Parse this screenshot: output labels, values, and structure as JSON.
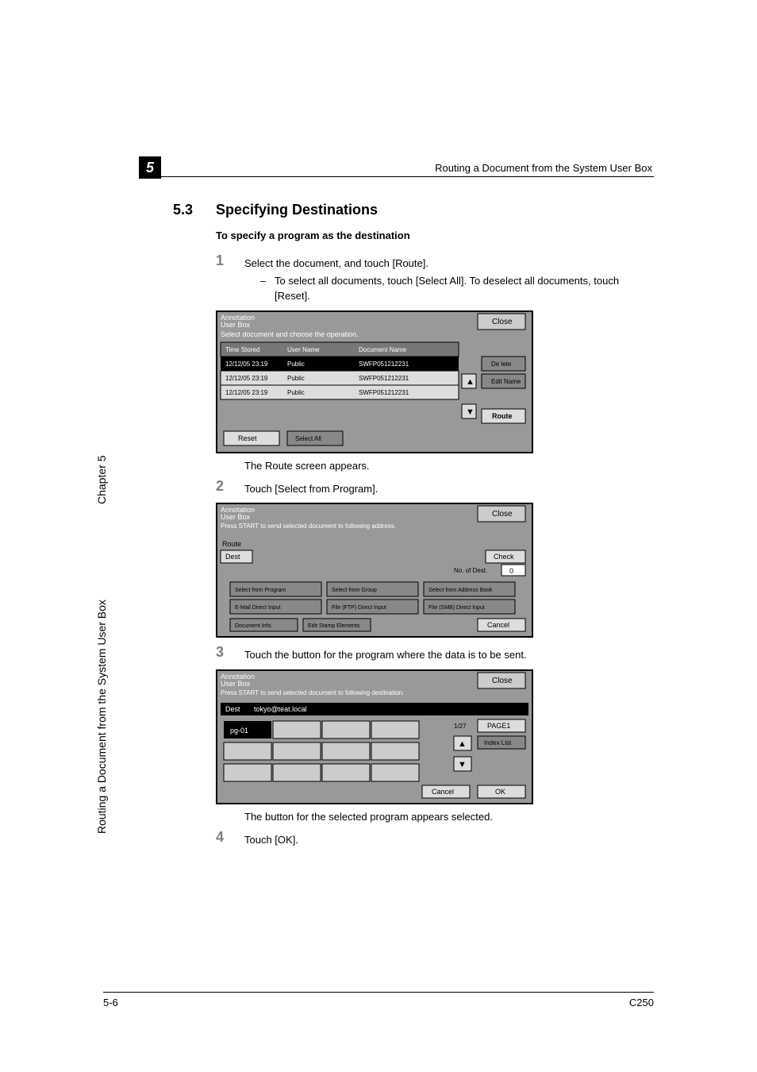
{
  "chapter_box_num": "5",
  "header_text": "Routing a Document from the System User Box",
  "section_num": "5.3",
  "section_title": "Specifying Destinations",
  "sub_heading": "To specify a program as the destination",
  "step1_num": "1",
  "step1_text": "Select the document, and touch [Route].",
  "step1_bullet": "To select all documents, touch [Select All]. To deselect all documents, touch [Reset].",
  "intertext1": "The Route screen appears.",
  "step2_num": "2",
  "step2_text": "Touch [Select from Program].",
  "step3_num": "3",
  "step3_text": "Touch the button for the program where the data is to be sent.",
  "intertext3": "The button for the selected program appears selected.",
  "step4_num": "4",
  "step4_text": "Touch [OK].",
  "sidebar_text": "Routing a Document from the System User Box",
  "sidebar_chapter": "Chapter 5",
  "footer_left": "5-6",
  "footer_right": "C250",
  "screen1": {
    "title1": "Annotation",
    "title2": "User Box",
    "prompt": "Select document and choose the operation.",
    "close": "Close",
    "col_time": "Time Stored",
    "col_user": "User Name",
    "col_doc": "Document Name",
    "rows": [
      {
        "time": "12/12/05 23:19",
        "user": "Public",
        "doc": "SWFP051212231",
        "sel": true
      },
      {
        "time": "12/12/05 23:19",
        "user": "Public",
        "doc": "SWFP051212231",
        "sel": false
      },
      {
        "time": "12/12/05 23:19",
        "user": "Public",
        "doc": "SWFP051212231",
        "sel": false
      }
    ],
    "delete": "De lete",
    "edit": "Edit Name",
    "route": "Route",
    "reset": "Reset",
    "select_all": "Select All"
  },
  "screen2": {
    "title1": "Annotation",
    "title2": "User Box",
    "prompt": "Press START to send selected document to following address.",
    "close": "Close",
    "route": "Route",
    "dest": "Dest",
    "check": "Check",
    "no_of": "No. of Dest.",
    "no_val": "0",
    "btns": [
      "Select from Program",
      "Select from Group",
      "Select from Address Book",
      "E-Mail Direct Input",
      "File (FTP) Direct Input",
      "File (SMB) Direct Input"
    ],
    "doc_info": "Document Info.",
    "edit_stamp": "Edit Stamp Elements",
    "cancel": "Cancel"
  },
  "screen3": {
    "title1": "Annotation",
    "title2": "User Box",
    "prompt": "Press START to send selected document to following destination.",
    "close": "Close",
    "dest": "Dest",
    "dest_val": "tokyo@teat.local",
    "pg": "pg-01",
    "frac": "1/27",
    "page1": "PAGE1",
    "index": "Index List",
    "cancel": "Cancel",
    "ok": "OK"
  }
}
